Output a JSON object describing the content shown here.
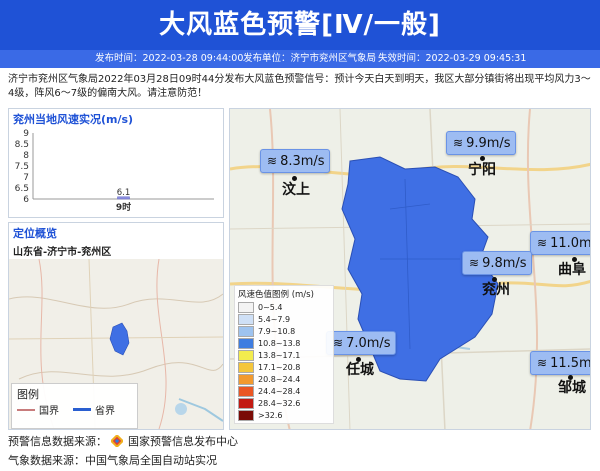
{
  "header": {
    "title": "大风蓝色预警[Ⅳ/一般]",
    "publish_time": "发布时间：2022-03-28 09:44:00",
    "publisher": "发布单位：济宁市兖州区气象局",
    "expire_time": "失效时间：2022-03-29 09:45:31"
  },
  "content": {
    "text": "济宁市兖州区气象局2022年03月28日09时44分发布大风蓝色预警信号：预计今天白天到明天，我区大部分镇街将出现平均风力3～4级，阵风6～7级的偏南大风。请注意防范！"
  },
  "wind_panel": {
    "title": "兖州当地风速实况(m/s)"
  },
  "chart_data": {
    "type": "bar",
    "categories": [
      "9时"
    ],
    "values": [
      6.1
    ],
    "data_labels": [
      "6.1"
    ],
    "title": "兖州当地风速实况(m/s)",
    "ylabel": "",
    "ylim": [
      6,
      9
    ],
    "yticks": [
      "9",
      "8.5",
      "8",
      "7.5",
      "7",
      "6.5",
      "6"
    ],
    "grid": false
  },
  "location_panel": {
    "title": "定位概览",
    "location": "山东省-济宁市-兖州区"
  },
  "overview_legend": {
    "title": "图例",
    "items": [
      "国界",
      "省界"
    ],
    "colors": [
      "#c87c7c",
      "#2a5fd0"
    ]
  },
  "map": {
    "stations": [
      {
        "city": "汶上",
        "speed": "8.3m/s"
      },
      {
        "city": "宁阳",
        "speed": "9.9m/s"
      },
      {
        "city": "曲阜",
        "speed": "11.0m/s"
      },
      {
        "city": "兖州",
        "speed": "9.8m/s"
      },
      {
        "city": "任城",
        "speed": "7.0m/s"
      },
      {
        "city": "邹城",
        "speed": "11.5m/s"
      }
    ],
    "legend_title": "风速色值图例 (m/s)",
    "legend": [
      {
        "label": "0~5.4",
        "color": "#f3f3f3"
      },
      {
        "label": "5.4~7.9",
        "color": "#cfe0f6"
      },
      {
        "label": "7.9~10.8",
        "color": "#9ec3ef"
      },
      {
        "label": "10.8~13.8",
        "color": "#3f7de0"
      },
      {
        "label": "13.8~17.1",
        "color": "#f3ec4e"
      },
      {
        "label": "17.1~20.8",
        "color": "#f4c63c"
      },
      {
        "label": "20.8~24.4",
        "color": "#f29a2f"
      },
      {
        "label": "24.4~28.4",
        "color": "#ea5724"
      },
      {
        "label": "28.4~32.6",
        "color": "#c21a12"
      },
      {
        "label": ">32.6",
        "color": "#7a0b06"
      }
    ],
    "region_color": "#3f6fe4"
  },
  "footer": {
    "warning_source": "预警信息数据来源：",
    "warning_source_name": "国家预警信息发布中心",
    "weather_source": "气象数据来源：中国气象局全国自动站实况"
  }
}
